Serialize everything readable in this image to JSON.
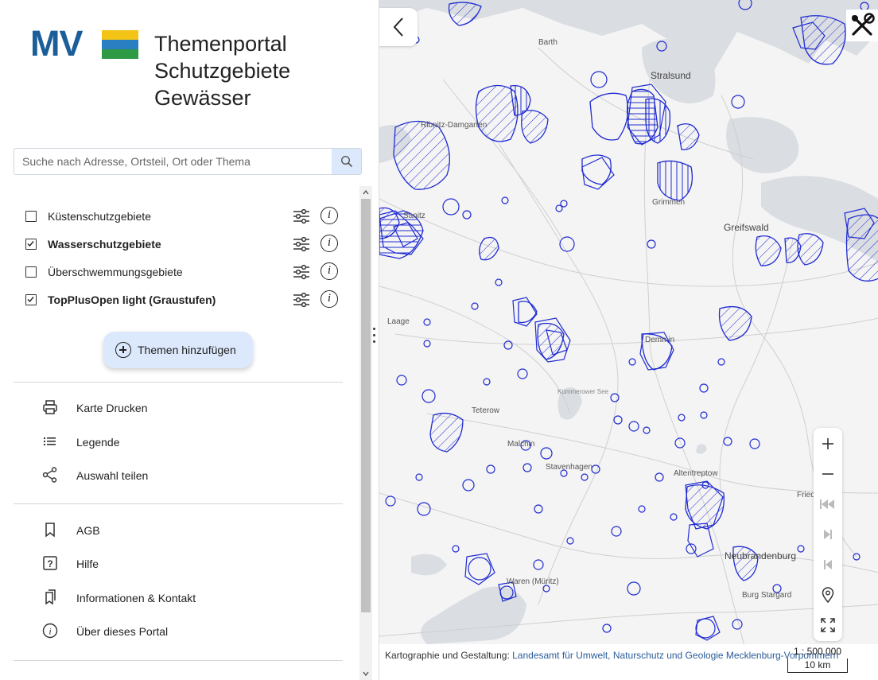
{
  "app": {
    "logo_text": "MV",
    "title_lines": [
      "Themenportal",
      "Schutzgebiete",
      "Gewässer"
    ],
    "brand_color": "#1b5e9a",
    "accent_color": "#dce8fb"
  },
  "search": {
    "placeholder": "Suche nach Adresse, Ortsteil, Ort oder Thema",
    "value": "",
    "icon": "search-icon"
  },
  "layers": [
    {
      "label": "Küstenschutzgebiete",
      "checked": false,
      "bold": false
    },
    {
      "label": "Wasserschutzgebiete",
      "checked": true,
      "bold": true
    },
    {
      "label": "Überschwemmungsgebiete",
      "checked": false,
      "bold": false
    },
    {
      "label": "TopPlusOpen light (Graustufen)",
      "checked": true,
      "bold": true
    }
  ],
  "add_themes_label": "Themen hinzufügen",
  "menu_tools": [
    {
      "label": "Karte Drucken",
      "icon": "printer-icon"
    },
    {
      "label": "Legende",
      "icon": "list-icon"
    },
    {
      "label": "Auswahl teilen",
      "icon": "share-icon"
    }
  ],
  "menu_info": [
    {
      "label": "AGB",
      "icon": "bookmark-icon"
    },
    {
      "label": "Hilfe",
      "icon": "help-icon"
    },
    {
      "label": "Informationen & Kontakt",
      "icon": "bookmarks-icon"
    },
    {
      "label": "Über dieses Portal",
      "icon": "info-icon"
    }
  ],
  "map": {
    "places": [
      "Barth",
      "Stralsund",
      "Ribnitz-Damgarten",
      "Grimmen",
      "Greifswald",
      "Sanitz",
      "Laage",
      "Demmin",
      "Teterow",
      "Malchin",
      "Stavenhagen",
      "Altentreptow",
      "Neubrandenburg",
      "Burg Stargard",
      "Waren (Müritz)",
      "Friedland",
      "Kummerower See"
    ],
    "overlay_color": "#1f2bd1",
    "attribution_prefix": "Kartographie und Gestaltung:",
    "attribution_link": "Landesamt für Umwelt, Naturschutz und Geologie Mecklenburg-Vorpommern",
    "scale_ratio": "1 : 500.000",
    "scale_bar": "10 km"
  }
}
